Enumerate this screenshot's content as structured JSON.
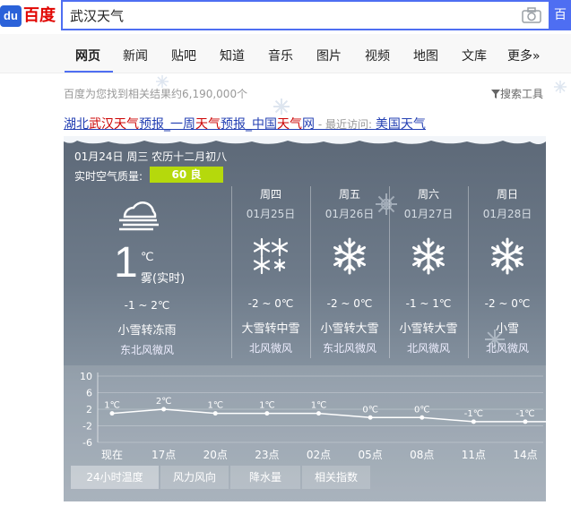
{
  "logo": {
    "mark": "du",
    "text": "百度"
  },
  "search": {
    "query": "武汉天气",
    "button_label": "百"
  },
  "nav": {
    "tabs": [
      "网页",
      "新闻",
      "贴吧",
      "知道",
      "音乐",
      "图片",
      "视频",
      "地图",
      "文库",
      "更多»"
    ],
    "active": "网页"
  },
  "result_count": "百度为您找到相关结果约6,190,000个",
  "tools_label": "搜索工具",
  "result": {
    "title_prefix": "湖北",
    "title_kw1": "武汉天气",
    "title_mid1": "预报_一周",
    "title_kw2": "天气",
    "title_mid2": "预报_中国",
    "title_kw3": "天气",
    "title_suffix": "网",
    "recent_label": " - 最近访问: ",
    "recent_link": "美国天气"
  },
  "today": {
    "date_line": "01月24日 周三 农历十二月初八",
    "aq_label": "实时空气质量:",
    "aq_value": "60 良",
    "aq_color": "#b5d90c",
    "temp": "1",
    "unit": "℃",
    "desc": "雾(实时)",
    "range": "-1 ~ 2℃",
    "weather": "小雪转冻雨",
    "wind": "东北风微风",
    "icon": "fog-cloud-icon"
  },
  "forecast": [
    {
      "day": "周四",
      "date": "01月25日",
      "range": "-2 ~ 0℃",
      "weather": "大雪转中雪",
      "wind": "北风微风",
      "icon": "heavy-snow-icon"
    },
    {
      "day": "周五",
      "date": "01月26日",
      "range": "-2 ~ 0℃",
      "weather": "小雪转大雪",
      "wind": "东北风微风",
      "icon": "snowflake-icon"
    },
    {
      "day": "周六",
      "date": "01月27日",
      "range": "-1 ~ 1℃",
      "weather": "小雪转大雪",
      "wind": "北风微风",
      "icon": "snowflake-icon"
    },
    {
      "day": "周日",
      "date": "01月28日",
      "range": "-2 ~ 0℃",
      "weather": "小雪",
      "wind": "北风微风",
      "icon": "snowflake-icon"
    }
  ],
  "chart_data": {
    "type": "line",
    "title": "",
    "x": [
      "现在",
      "17点",
      "20点",
      "23点",
      "02点",
      "05点",
      "08点",
      "11点",
      "14点"
    ],
    "values": [
      1,
      2,
      1,
      1,
      1,
      0,
      0,
      -1,
      -1
    ],
    "point_labels": [
      "1℃",
      "2℃",
      "1℃",
      "1℃",
      "1℃",
      "0℃",
      "0℃",
      "-1℃",
      "-1℃"
    ],
    "yticks": [
      "10",
      "6",
      "2",
      "-2",
      "-6"
    ],
    "ylim": [
      -6,
      10
    ],
    "grid": true
  },
  "bottom_tabs": [
    "24小时温度",
    "风力风向",
    "降水量",
    "相关指数"
  ],
  "bottom_tab_active": "24小时温度"
}
